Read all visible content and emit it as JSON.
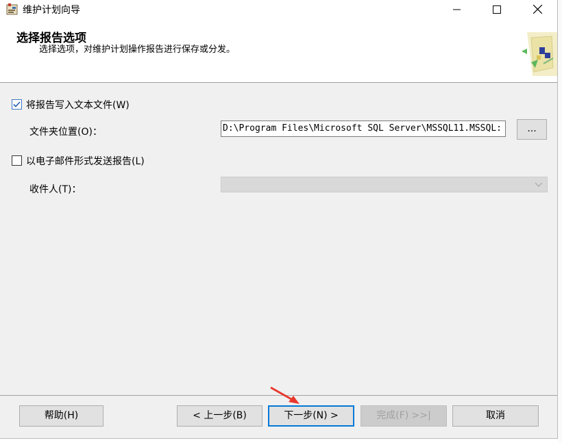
{
  "window": {
    "title": "维护计划向导",
    "controls": {
      "minimize": "—",
      "maximize": "☐",
      "close": "✕"
    }
  },
  "header": {
    "title": "选择报告选项",
    "subtitle": "选择选项，对维护计划操作报告进行保存或分发。"
  },
  "options": {
    "write_to_file": {
      "label": "将报告写入文本文件(W)",
      "checked": true
    },
    "folder_location": {
      "label": "文件夹位置(O)：",
      "value": "D:\\Program Files\\Microsoft SQL Server\\MSSQL11.MSSQL:",
      "browse_label": "..."
    },
    "email": {
      "label": "以电子邮件形式发送报告(L)",
      "checked": false
    },
    "recipient": {
      "label": "收件人(T)：",
      "value": ""
    }
  },
  "footer": {
    "help": "帮助(H)",
    "back": "< 上一步(B)",
    "next": "下一步(N) >",
    "finish": "完成(F) >>|",
    "cancel": "取消"
  },
  "colors": {
    "accent": "#0078d7",
    "annotation_arrow": "#e8382e"
  }
}
